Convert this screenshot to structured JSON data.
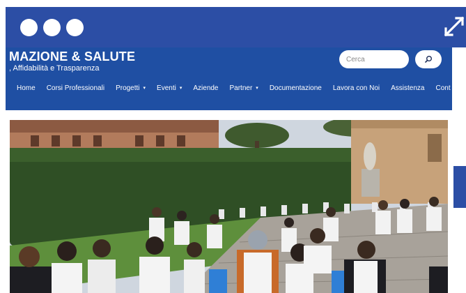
{
  "window": {
    "dots": [
      "close-dot",
      "minimize-dot",
      "maximize-dot"
    ],
    "expand_icon": "expand-arrows-icon"
  },
  "site": {
    "title": "MAZIONE & SALUTE",
    "tagline": ", Affidabilità e Trasparenza"
  },
  "search": {
    "placeholder": "Cerca",
    "icon": "search-icon"
  },
  "nav": {
    "items": [
      {
        "label": "Home",
        "dropdown": false
      },
      {
        "label": "Corsi Professionali",
        "dropdown": false
      },
      {
        "label": "Progetti",
        "dropdown": true
      },
      {
        "label": "Eventi",
        "dropdown": true
      },
      {
        "label": "Aziende",
        "dropdown": false
      },
      {
        "label": "Partner",
        "dropdown": true
      },
      {
        "label": "Documentazione",
        "dropdown": false
      },
      {
        "label": "Lavora con Noi",
        "dropdown": false
      },
      {
        "label": "Assistenza",
        "dropdown": false
      },
      {
        "label": "Cont",
        "dropdown": false
      }
    ],
    "caret": "▾"
  },
  "hero": {
    "subject": "students-cleanup-photo"
  },
  "colors": {
    "frame": "#2c4ea5",
    "header": "#1f4fa3",
    "text_on_header": "#ffffff"
  }
}
